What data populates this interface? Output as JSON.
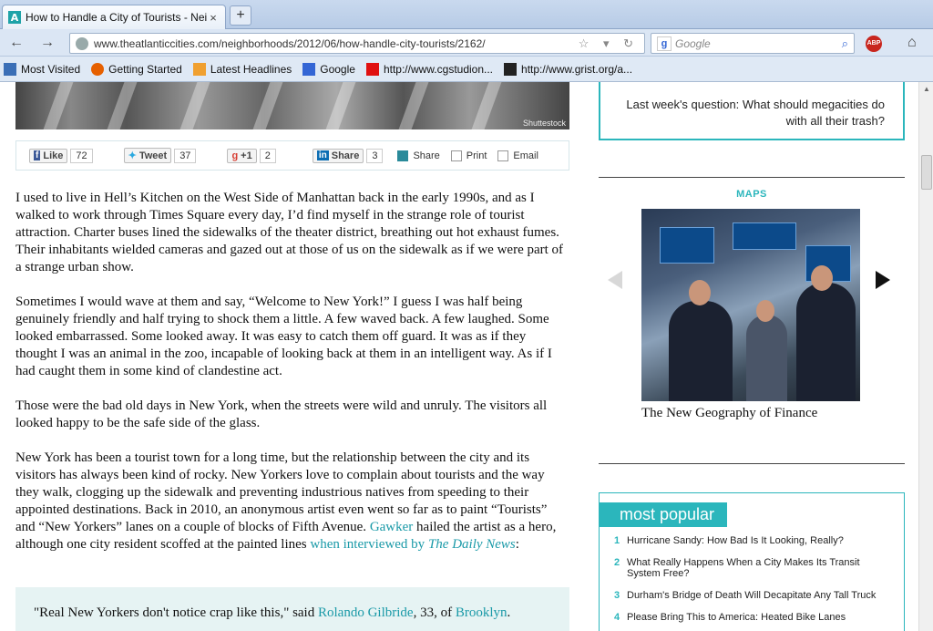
{
  "browser": {
    "tab_title": "How to Handle a City of Tourists - Neig...",
    "url": "www.theatlanticcities.com/neighborhoods/2012/06/how-handle-city-tourists/2162/",
    "search_placeholder": "Google",
    "abp_label": "ABP",
    "new_tab": "+",
    "tab_close": "×",
    "back": "←",
    "forward": "→",
    "url_icons": "☆ ▾ ↻",
    "search_go": "⌕",
    "home": "⌂",
    "bookmarks": [
      {
        "label": "Most Visited",
        "color": "#3b6fb6"
      },
      {
        "label": "Getting Started",
        "color": "#e66000"
      },
      {
        "label": "Latest Headlines",
        "color": "#f0a030"
      },
      {
        "label": "Google",
        "color": "#3466d5"
      },
      {
        "label": "http://www.cgstudion...",
        "color": "#e01010"
      },
      {
        "label": "http://www.grist.org/a...",
        "color": "#222222"
      }
    ]
  },
  "hero": {
    "credit": "Shuttestock"
  },
  "share": {
    "like_label": "Like",
    "like_count": "72",
    "tweet_label": "Tweet",
    "tweet_count": "37",
    "gplus_label": "+1",
    "gplus_count": "2",
    "linkedin_label": "Share",
    "linkedin_count": "3",
    "share_label": "Share",
    "print_label": "Print",
    "email_label": "Email"
  },
  "article": {
    "p1": "I used to live in Hell’s Kitchen on the West Side of Manhattan back in the early 1990s, and as I walked to work through Times Square every day, I’d find myself in the strange role of tourist attraction. Charter buses lined the sidewalks of the theater district, breathing out hot exhaust fumes. Their inhabitants wielded cameras and gazed out at those of us on the sidewalk as if we were part of a strange urban show.",
    "p2": "Sometimes I would wave at them and say, “Welcome to New York!” I guess I was half being genuinely friendly and half trying to shock them a little. A few waved back. A few laughed. Some looked embarrassed. Some looked away. It was easy to catch them off guard. It was as if they thought I was an animal in the zoo, incapable of looking back at them in an intelligent way. As if I had caught them in some kind of clandestine act.",
    "p3": "Those were the bad old days in New York, when the streets were wild and unruly. The visitors all looked happy to be the safe side of the glass.",
    "p4_a": "New York has been a tourist town for a long time, but the relationship between the city and its visitors has always been kind of rocky. New Yorkers love to complain about tourists and the way they walk, clogging up the sidewalk and preventing industrious natives from speeding to their appointed destinations. Back in 2010, an anonymous artist even went so far as to paint “Tourists” and “New Yorkers” lanes on a couple of blocks of Fifth Avenue. ",
    "p4_link1": "Gawker",
    "p4_b": " hailed the artist as a hero, although one city resident scoffed at the painted lines ",
    "p4_link2": "when interviewed by ",
    "p4_link2_italic": "The Daily News",
    "p4_c": ":",
    "quote_a": "\"Real New Yorkers don't notice crap like this,\" said ",
    "quote_link1": "Rolando Gilbride",
    "quote_b": ", 33, of ",
    "quote_link2": "Brooklyn",
    "quote_c": "."
  },
  "sidebar": {
    "last_week": "Last week's question: What should megacities do with all their trash?",
    "maps_label": "MAPS",
    "map_caption": "The New Geography of Finance",
    "popular_title": "most popular",
    "popular": [
      {
        "num": "1",
        "text": "Hurricane Sandy: How Bad Is It Looking, Really?"
      },
      {
        "num": "2",
        "text": "What Really Happens When a City Makes Its Transit System Free?"
      },
      {
        "num": "3",
        "text": "Durham's Bridge of Death Will Decapitate Any Tall Truck"
      },
      {
        "num": "4",
        "text": "Please Bring This to America: Heated Bike Lanes"
      }
    ]
  }
}
